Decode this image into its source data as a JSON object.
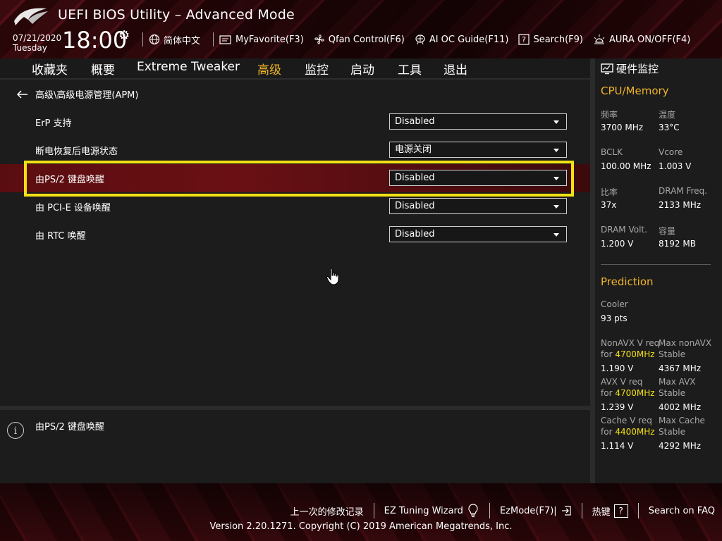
{
  "header": {
    "title": "UEFI BIOS Utility – Advanced Mode",
    "date": "07/21/2020",
    "day": "Tuesday",
    "time": "18:00",
    "toolbar": [
      {
        "label": "简体中文",
        "icon": "globe-icon"
      },
      {
        "label": "MyFavorite(F3)",
        "icon": "favorite-icon"
      },
      {
        "label": "Qfan Control(F6)",
        "icon": "fan-icon"
      },
      {
        "label": "AI OC Guide(F11)",
        "icon": "ai-oc-icon"
      },
      {
        "label": "Search(F9)",
        "icon": "search-icon"
      },
      {
        "label": "AURA ON/OFF(F4)",
        "icon": "aura-icon"
      }
    ]
  },
  "tabs": [
    {
      "label": "收藏夹"
    },
    {
      "label": "概要"
    },
    {
      "label": "Extreme Tweaker"
    },
    {
      "label": "高级",
      "active": true
    },
    {
      "label": "监控"
    },
    {
      "label": "启动"
    },
    {
      "label": "工具"
    },
    {
      "label": "退出"
    }
  ],
  "breadcrumb": "高级\\高级电源管理(APM)",
  "settings": [
    {
      "label": "ErP 支持",
      "value": "Disabled"
    },
    {
      "label": "断电恢复后电源状态",
      "value": "电源关闭"
    },
    {
      "label": "由PS/2 键盘唤醒",
      "value": "Disabled",
      "selected": true
    },
    {
      "label": "由 PCI-E 设备唤醒",
      "value": "Disabled"
    },
    {
      "label": "由 RTC 唤醒",
      "value": "Disabled"
    }
  ],
  "help_text": "由PS/2 键盘唤醒",
  "monitor": {
    "title": "硬件监控",
    "cpu_section": "CPU/Memory",
    "freq_label": "频率",
    "freq_value": "3700 MHz",
    "temp_label": "温度",
    "temp_value": "33°C",
    "bclk_label": "BCLK",
    "bclk_value": "100.00 MHz",
    "vcore_label": "Vcore",
    "vcore_value": "1.003 V",
    "ratio_label": "比率",
    "ratio_value": "37x",
    "dramfreq_label": "DRAM Freq.",
    "dramfreq_value": "2133 MHz",
    "dramvolt_label": "DRAM Volt.",
    "dramvolt_value": "1.200 V",
    "capacity_label": "容量",
    "capacity_value": "8192 MB",
    "prediction_section": "Prediction",
    "cooler_label": "Cooler",
    "cooler_value": "93 pts",
    "nonavx_req": "NonAVX V req",
    "for_label": "for",
    "nonavx_freq": "4700MHz",
    "nonavx_max": "Max nonAVX",
    "stable": "Stable",
    "nonavx_v": "1.190 V",
    "nonavx_mhz": "4367 MHz",
    "avx_req": "AVX V req",
    "avx_freq": "4700MHz",
    "avx_max": "Max AVX",
    "avx_v": "1.239 V",
    "avx_mhz": "4002 MHz",
    "cache_req": "Cache V req",
    "cache_freq": "4400MHz",
    "cache_max": "Max Cache",
    "cache_v": "1.114 V",
    "cache_mhz": "4292 MHz"
  },
  "footer": {
    "last_modified": "上一次的修改记录",
    "ez_tuning": "EZ Tuning Wizard",
    "ezmode": "EzMode(F7)|",
    "hotkeys": "热键",
    "hotkeys_icon": "?",
    "faq": "Search on FAQ",
    "copyright": "Version 2.20.1271. Copyright (C) 2019 American Megatrends, Inc."
  },
  "colors": {
    "accent": "#f0b428",
    "highlight": "#f3e013",
    "selected_row": "#6a1014"
  }
}
